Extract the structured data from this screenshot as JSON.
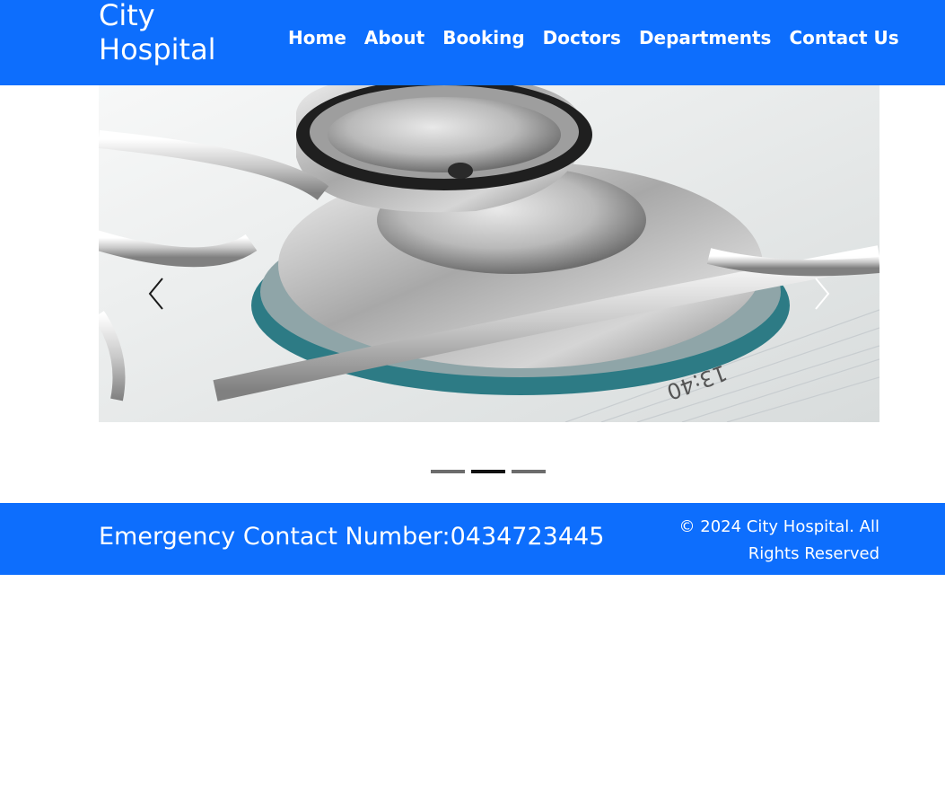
{
  "brand": {
    "name": "City Hospital"
  },
  "nav": {
    "items": [
      {
        "label": "Home"
      },
      {
        "label": "About"
      },
      {
        "label": "Booking"
      },
      {
        "label": "Doctors"
      },
      {
        "label": "Departments"
      },
      {
        "label": "Contact Us"
      }
    ]
  },
  "carousel": {
    "image": "stethoscope-on-schedule-photo",
    "prev_icon": "chevron-left-icon",
    "next_icon": "chevron-right-icon",
    "indicator_count": 3,
    "active_indicator": 2
  },
  "footer": {
    "emergency_label": "Emergency Contact Number:",
    "emergency_number": "0434723445",
    "copyright": "© 2024 City Hospital. All Rights Reserved"
  },
  "colors": {
    "primary": "#0d6efd",
    "text_on_primary": "#ffffff",
    "indicator_active": "#111111",
    "indicator_inactive": "#6c6c6c"
  }
}
